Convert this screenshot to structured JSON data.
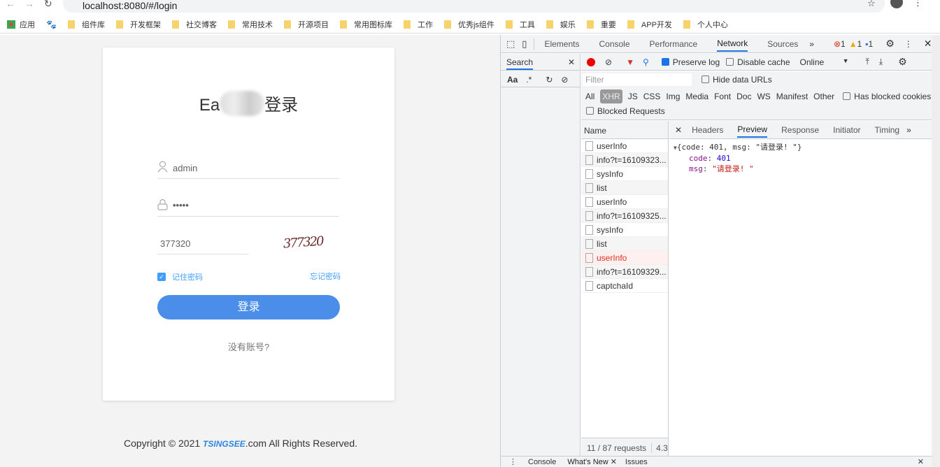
{
  "browser": {
    "url": "localhost:8080/#/login",
    "bookmarks": [
      "应用",
      "组件库",
      "开发框架",
      "社交博客",
      "常用技术",
      "开源项目",
      "常用图标库",
      "工作",
      "优秀js组件",
      "工具",
      "娱乐",
      "重要",
      "APP开发",
      "个人中心"
    ]
  },
  "login": {
    "title_start": "Ea",
    "title_end": "登录",
    "username": "admin",
    "password": "•••••",
    "captcha_value": "377320",
    "captcha_image_text": "377320",
    "remember_label": "记住密码",
    "remember_checked": true,
    "forgot_label": "忘记密码",
    "login_button": "登录",
    "no_account": "没有账号?",
    "copyright_prefix": "Copyright © 2021 ",
    "brand": "TSINGSEE",
    "copyright_suffix": ".com All Rights Reserved.",
    "accent": "#4a8eea"
  },
  "devtools": {
    "tabs": [
      "Elements",
      "Console",
      "Performance",
      "Network",
      "Sources"
    ],
    "active_tab": "Network",
    "errors": "1",
    "warnings": "1",
    "messages": "1",
    "search_label": "Search",
    "search_aa": "Aa",
    "search_regex": ".*",
    "preserve_log": "Preserve log",
    "disable_cache": "Disable cache",
    "throttle": "Online",
    "filter_placeholder": "Filter",
    "hide_data_urls": "Hide data URLs",
    "types": [
      "All",
      "XHR",
      "JS",
      "CSS",
      "Img",
      "Media",
      "Font",
      "Doc",
      "WS",
      "Manifest",
      "Other"
    ],
    "active_type": "XHR",
    "has_blocked_cookies": "Has blocked cookies",
    "blocked_requests": "Blocked Requests",
    "name_header": "Name",
    "requests": [
      {
        "name": "userInfo"
      },
      {
        "name": "info?t=16109323..."
      },
      {
        "name": "sysInfo"
      },
      {
        "name": "list"
      },
      {
        "name": "userInfo"
      },
      {
        "name": "info?t=16109325..."
      },
      {
        "name": "sysInfo"
      },
      {
        "name": "list"
      },
      {
        "name": "userInfo",
        "error": true
      },
      {
        "name": "info?t=16109329..."
      },
      {
        "name": "captchaId"
      }
    ],
    "detail_tabs": [
      "Headers",
      "Preview",
      "Response",
      "Initiator",
      "Timing"
    ],
    "active_detail_tab": "Preview",
    "preview": {
      "summary": "{code: 401, msg: \"请登录! \"}",
      "code_key": "code",
      "code_value": "401",
      "msg_key": "msg",
      "msg_value": "\"请登录! \""
    },
    "status": "11 / 87 requests",
    "status_size": "4.3",
    "drawer_tabs": [
      "Console",
      "What's New",
      "Issues"
    ]
  }
}
